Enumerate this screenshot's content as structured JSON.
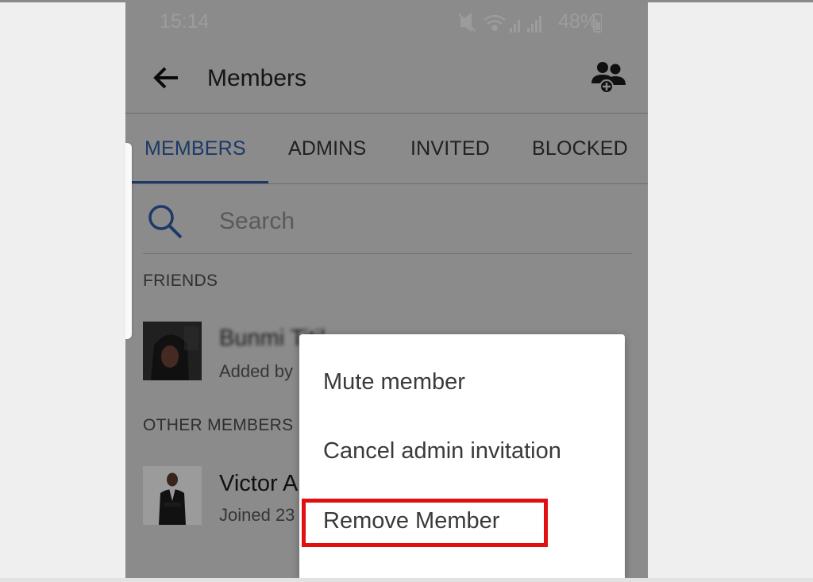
{
  "status_bar": {
    "time": "15:14",
    "battery": "48%"
  },
  "app_bar": {
    "title": "Members",
    "back_icon": "arrow-left-icon",
    "action_icon": "add-members-icon"
  },
  "tabs": [
    {
      "label": "MEMBERS",
      "active": true
    },
    {
      "label": "ADMINS",
      "active": false
    },
    {
      "label": "INVITED",
      "active": false
    },
    {
      "label": "BLOCKED",
      "active": false
    }
  ],
  "search": {
    "placeholder": "Search"
  },
  "sections": {
    "friends": "FRIENDS",
    "other_members": "OTHER MEMBERS"
  },
  "members": [
    {
      "name": "Bunmi Titil",
      "sub": "Added by"
    },
    {
      "name": "Victor A",
      "sub": "Joined 23"
    }
  ],
  "context_menu": {
    "items": [
      {
        "label": "Mute member"
      },
      {
        "label": "Cancel admin invitation"
      },
      {
        "label": "Remove Member",
        "highlighted": true
      }
    ]
  },
  "colors": {
    "accent": "#2d5aa6",
    "highlight": "#e01010"
  }
}
